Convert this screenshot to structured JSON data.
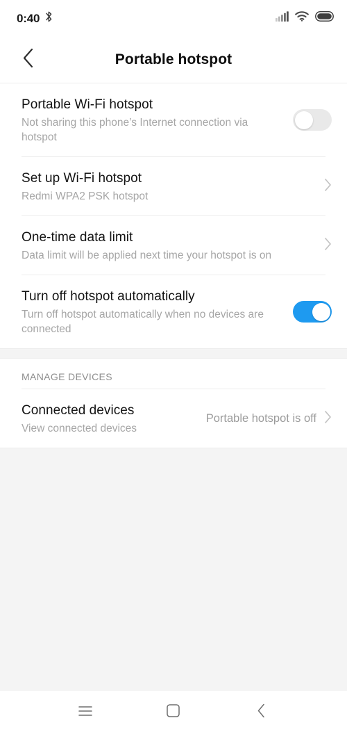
{
  "status_bar": {
    "clock": "0:40",
    "bluetooth_icon": "bluetooth-icon",
    "signal_icon": "cellular-signal-icon",
    "wifi_icon": "wifi-icon",
    "battery_icon": "battery-full-icon"
  },
  "header": {
    "back_icon": "back-chevron-icon",
    "title": "Portable hotspot"
  },
  "settings": {
    "hotspot_toggle": {
      "title": "Portable Wi-Fi hotspot",
      "subtitle": "Not sharing this phone’s Internet connection via hotspot",
      "state": "off"
    },
    "setup": {
      "title": "Set up Wi-Fi hotspot",
      "subtitle": "Redmi WPA2 PSK hotspot",
      "chevron": "chevron-right-icon"
    },
    "data_limit": {
      "title": "One-time data limit",
      "subtitle": "Data limit will be applied next time your hotspot is on",
      "chevron": "chevron-right-icon"
    },
    "auto_off": {
      "title": "Turn off hotspot automatically",
      "subtitle": "Turn off hotspot automatically when no devices are connected",
      "state": "on"
    }
  },
  "manage_devices": {
    "section_label": "MANAGE DEVICES",
    "connected_devices": {
      "title": "Connected devices",
      "subtitle": "View connected devices",
      "value": "Portable hotspot is off",
      "chevron": "chevron-right-icon"
    }
  },
  "nav_bar": {
    "recents_icon": "menu-icon",
    "home_icon": "home-square-icon",
    "back_icon": "back-chevron-icon"
  },
  "colors": {
    "toggle_on": "#1e9af0",
    "toggle_off": "#e9e9e9",
    "background": "#f4f4f4",
    "surface": "#ffffff",
    "title_text": "#131313",
    "subtitle_text": "#a6a6a6"
  }
}
